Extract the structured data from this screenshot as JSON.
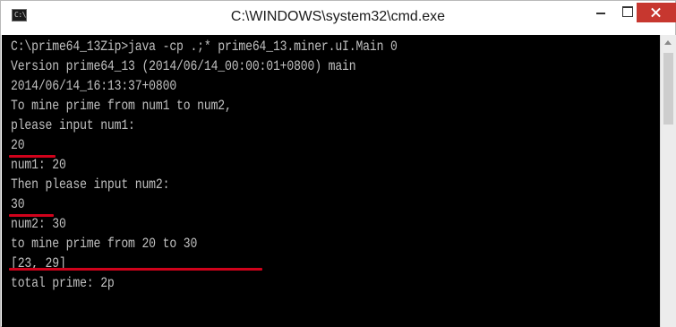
{
  "window": {
    "title": "C:\\WINDOWS\\system32\\cmd.exe",
    "icon_text": "C:\\"
  },
  "console": {
    "lines": [
      "C:\\prime64_13Zip>java -cp .;* prime64_13.miner.uI.Main 0",
      "Version prime64_13 (2014/06/14_00:00:01+0800) main",
      "2014/06/14_16:13:37+0800",
      "To mine prime from num1 to num2,",
      "please input num1:",
      "20",
      "num1: 20",
      "Then please input num2:",
      "30",
      "num2: 30",
      "to mine prime from 20 to 30",
      "[23, 29]",
      "total prime: 2p"
    ]
  },
  "colors": {
    "console_bg": "#000000",
    "console_text": "#c0c0c0",
    "annotation_underline": "#d0021b",
    "close_button": "#c7372f"
  },
  "icons": [
    "cmd-app-icon",
    "minimize-icon",
    "maximize-icon",
    "close-icon",
    "scroll-up-arrow-icon"
  ]
}
